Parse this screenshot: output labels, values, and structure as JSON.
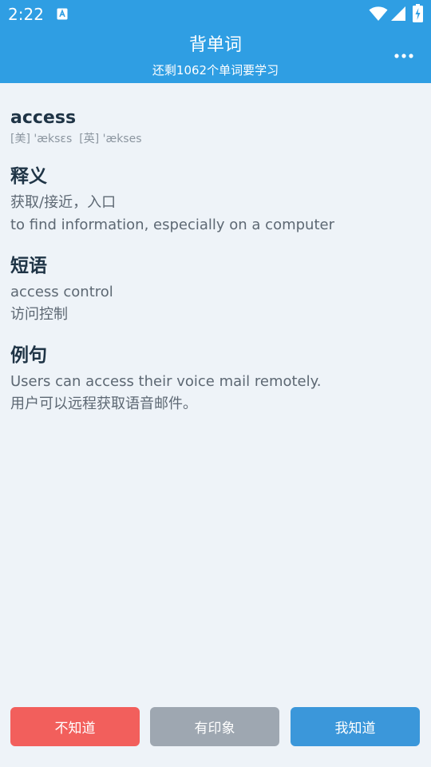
{
  "status_bar": {
    "time": "2:22",
    "icons": [
      "app-notification-icon",
      "wifi-icon",
      "cell-signal-icon",
      "battery-charging-icon"
    ]
  },
  "app_bar": {
    "title": "背单词",
    "subtitle": "还剩1062个单词要学习",
    "more_icon": "more-dots-icon"
  },
  "word": {
    "text": "access",
    "phonetic_us": "[美] 'æksɛs",
    "phonetic_uk": "[英] 'ækses"
  },
  "sections": {
    "meaning": {
      "title": "释义",
      "lines": [
        "获取/接近，入口",
        "to find information, especially on a computer"
      ]
    },
    "phrase": {
      "title": "短语",
      "lines": [
        "access control",
        "访问控制"
      ]
    },
    "example": {
      "title": "例句",
      "lines": [
        "Users can access their voice mail remotely.",
        "用户可以远程获取语音邮件。"
      ]
    }
  },
  "buttons": {
    "unknown": "不知道",
    "vague": "有印象",
    "known": "我知道"
  },
  "colors": {
    "header_bg": "#2f9ee3",
    "page_bg": "#eef3f8",
    "unknown_btn": "#f25f5c",
    "vague_btn": "#9ea7b1",
    "known_btn": "#3b97da"
  }
}
